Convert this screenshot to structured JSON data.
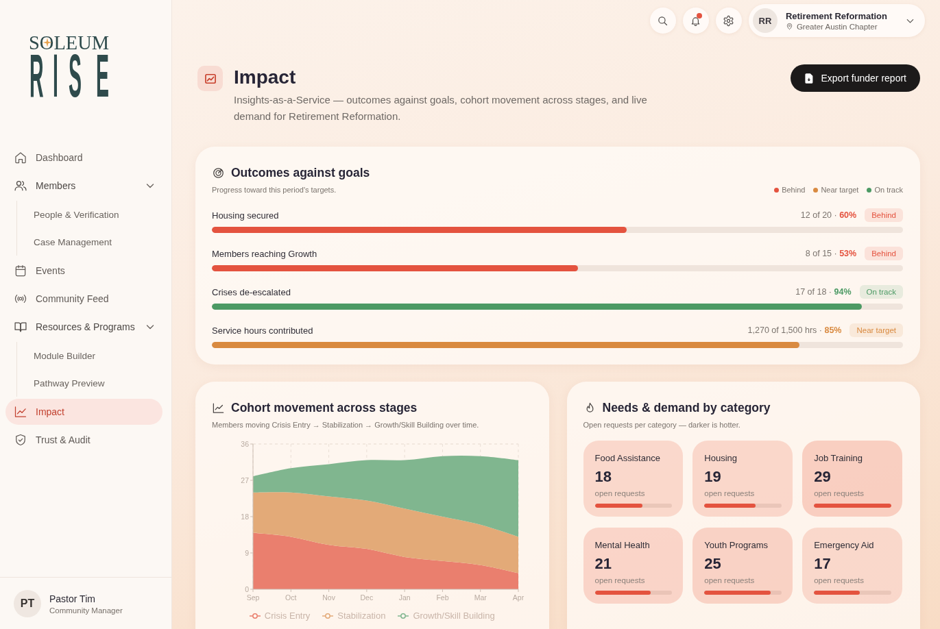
{
  "sidebar": {
    "logo": {
      "top_line": "SOLEUM",
      "bottom_line": "RISE"
    },
    "items": [
      {
        "label": "Dashboard",
        "selected": false
      },
      {
        "label": "Members",
        "selected": false,
        "expanded": true,
        "children": [
          {
            "label": "People & Verification",
            "selected": false
          },
          {
            "label": "Case Management",
            "selected": false
          }
        ]
      },
      {
        "label": "Events",
        "selected": false
      },
      {
        "label": "Community Feed",
        "selected": false
      },
      {
        "label": "Resources & Programs",
        "selected": false,
        "expanded": true,
        "children": [
          {
            "label": "Module Builder",
            "selected": false
          },
          {
            "label": "Pathway Preview",
            "selected": false
          }
        ]
      },
      {
        "label": "Impact",
        "selected": true
      },
      {
        "label": "Trust & Audit",
        "selected": false
      }
    ],
    "user": {
      "initials": "PT",
      "name": "Pastor Tim",
      "role": "Community Manager"
    }
  },
  "top_bar": {
    "notifications": {
      "unread": true
    },
    "organization": {
      "initials": "RR",
      "name": "Retirement Reformation",
      "chapter": "Greater Austin Chapter"
    }
  },
  "page_header": {
    "title": "Impact",
    "subtitle": "Insights-as-a-Service — outcomes against goals, cohort movement across stages, and live demand for Retirement Reformation.",
    "export_button": "Export funder report"
  },
  "outcomes": {
    "title": "Outcomes against goals",
    "subtitle": "Progress toward this period's targets.",
    "legend": [
      {
        "label": "Behind",
        "color": "#e4533f"
      },
      {
        "label": "Near target",
        "color": "#d98a40"
      },
      {
        "label": "On track",
        "color": "#4c9a64"
      }
    ],
    "rows": [
      {
        "label": "Housing secured",
        "progress": "12 of 20 ·",
        "percent": "60%",
        "badge": "Behind",
        "color": "#e4533f",
        "level": 0.6
      },
      {
        "label": "Members reaching Growth",
        "progress": "8 of 15 ·",
        "percent": "53%",
        "badge": "Behind",
        "color": "#e4533f",
        "level": 0.53
      },
      {
        "label": "Crises de-escalated",
        "progress": "17 of 18 ·",
        "percent": "94%",
        "badge": "On track",
        "color": "#4c9a64",
        "level": 0.94
      },
      {
        "label": "Service hours contributed",
        "progress": "1,270 of 1,500 hrs ·",
        "percent": "85%",
        "badge": "Near target",
        "color": "#d98a40",
        "level": 0.85
      }
    ]
  },
  "cohort": {
    "title": "Cohort movement across stages",
    "subtitle": "Members moving Crisis Entry → Stabilization → Growth/Skill Building over time.",
    "chart_data": {
      "type": "area",
      "stacked": true,
      "grid": true,
      "categories": [
        "Sep",
        "Oct",
        "Nov",
        "Dec",
        "Jan",
        "Feb",
        "Mar",
        "Apr"
      ],
      "series": [
        {
          "name": "Crisis Entry",
          "color": "#ea7f6e",
          "values": [
            14,
            13,
            11,
            10,
            8,
            7,
            6,
            4
          ]
        },
        {
          "name": "Stabilization",
          "color": "#e3aa78",
          "values": [
            10,
            11,
            12,
            12,
            12,
            11,
            10,
            9
          ]
        },
        {
          "name": "Growth/Skill Building",
          "color": "#80b68f",
          "values": [
            4,
            6,
            8,
            10,
            12,
            15,
            17,
            19
          ]
        }
      ],
      "ylim": [
        0,
        36
      ],
      "yticks": [
        0,
        9,
        18,
        27,
        36
      ]
    }
  },
  "needs": {
    "title": "Needs & demand by category",
    "subtitle": "Open requests per category — darker is hotter.",
    "categories": [
      {
        "label": "Food Assistance",
        "count": "18",
        "unit": "open requests",
        "level": 0.62
      },
      {
        "label": "Housing",
        "count": "19",
        "unit": "open requests",
        "level": 0.66
      },
      {
        "label": "Job Training",
        "count": "29",
        "unit": "open requests",
        "level": 1.0
      },
      {
        "label": "Mental Health",
        "count": "21",
        "unit": "open requests",
        "level": 0.72
      },
      {
        "label": "Youth Programs",
        "count": "25",
        "unit": "open requests",
        "level": 0.86
      },
      {
        "label": "Emergency Aid",
        "count": "17",
        "unit": "open requests",
        "level": 0.59
      }
    ]
  }
}
